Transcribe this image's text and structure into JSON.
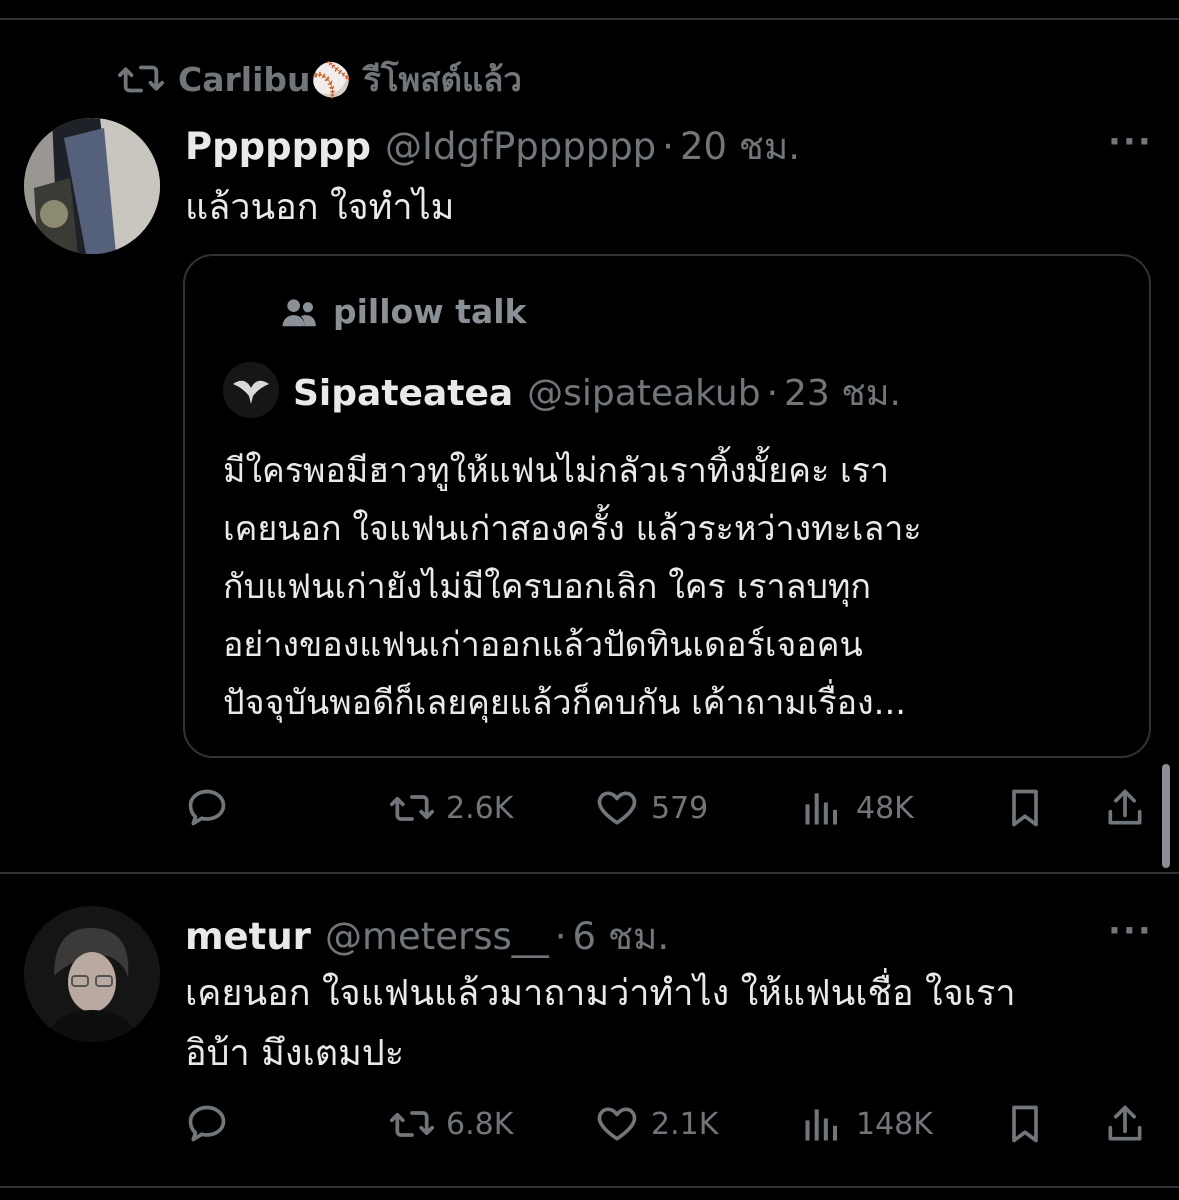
{
  "repost": {
    "icon": "repost-icon",
    "user": "Carlibu",
    "emoji": "⚾",
    "label": "รีโพสต์แล้ว"
  },
  "tweets": [
    {
      "name": "Ppppppp",
      "handle": "@IdgfPpppppp",
      "separator": "·",
      "time": "20 ชม.",
      "more": "···",
      "text": "แล้วนอก ใจทำไม",
      "quote": {
        "community": "pillow talk",
        "community_icon": "community-icon",
        "name": "Sipateatea",
        "handle": "@sipateakub",
        "separator": "·",
        "time": "23 ชม.",
        "lines": [
          "มีใครพอมีฮาวทูให้แฟนไม่กลัวเราทิ้งมั้ยคะ เรา",
          "เคยนอก ใจแฟนเก่าสองครั้ง แล้วระหว่างทะเลาะ",
          "กับแฟนเก่ายังไม่มีใครบอกเลิก ใคร เราลบทุก",
          "อย่างของแฟนเก่าออกแล้วปัดทินเดอร์เจอคน",
          "ปัจจุบันพอดีก็เลยคุยแล้วก็คบกัน เค้าถามเรื่อง..."
        ]
      },
      "actions": {
        "replies": "",
        "reposts": "2.6K",
        "likes": "579",
        "views": "48K"
      }
    },
    {
      "name": "metur",
      "handle": "@meterss__",
      "separator": "·",
      "time": "6 ชม.",
      "more": "···",
      "lines": [
        "เคยนอก ใจแฟนแล้วมาถามว่าทำไง ให้แฟนเชื่อ ใจเรา",
        "อิบ้า มึงเตมปะ"
      ],
      "actions": {
        "replies": "",
        "reposts": "6.8K",
        "likes": "2.1K",
        "views": "148K"
      }
    }
  ],
  "colors": {
    "background": "#000000",
    "text": "#e7e9ea",
    "muted": "#71767b",
    "border": "#2f3336"
  }
}
